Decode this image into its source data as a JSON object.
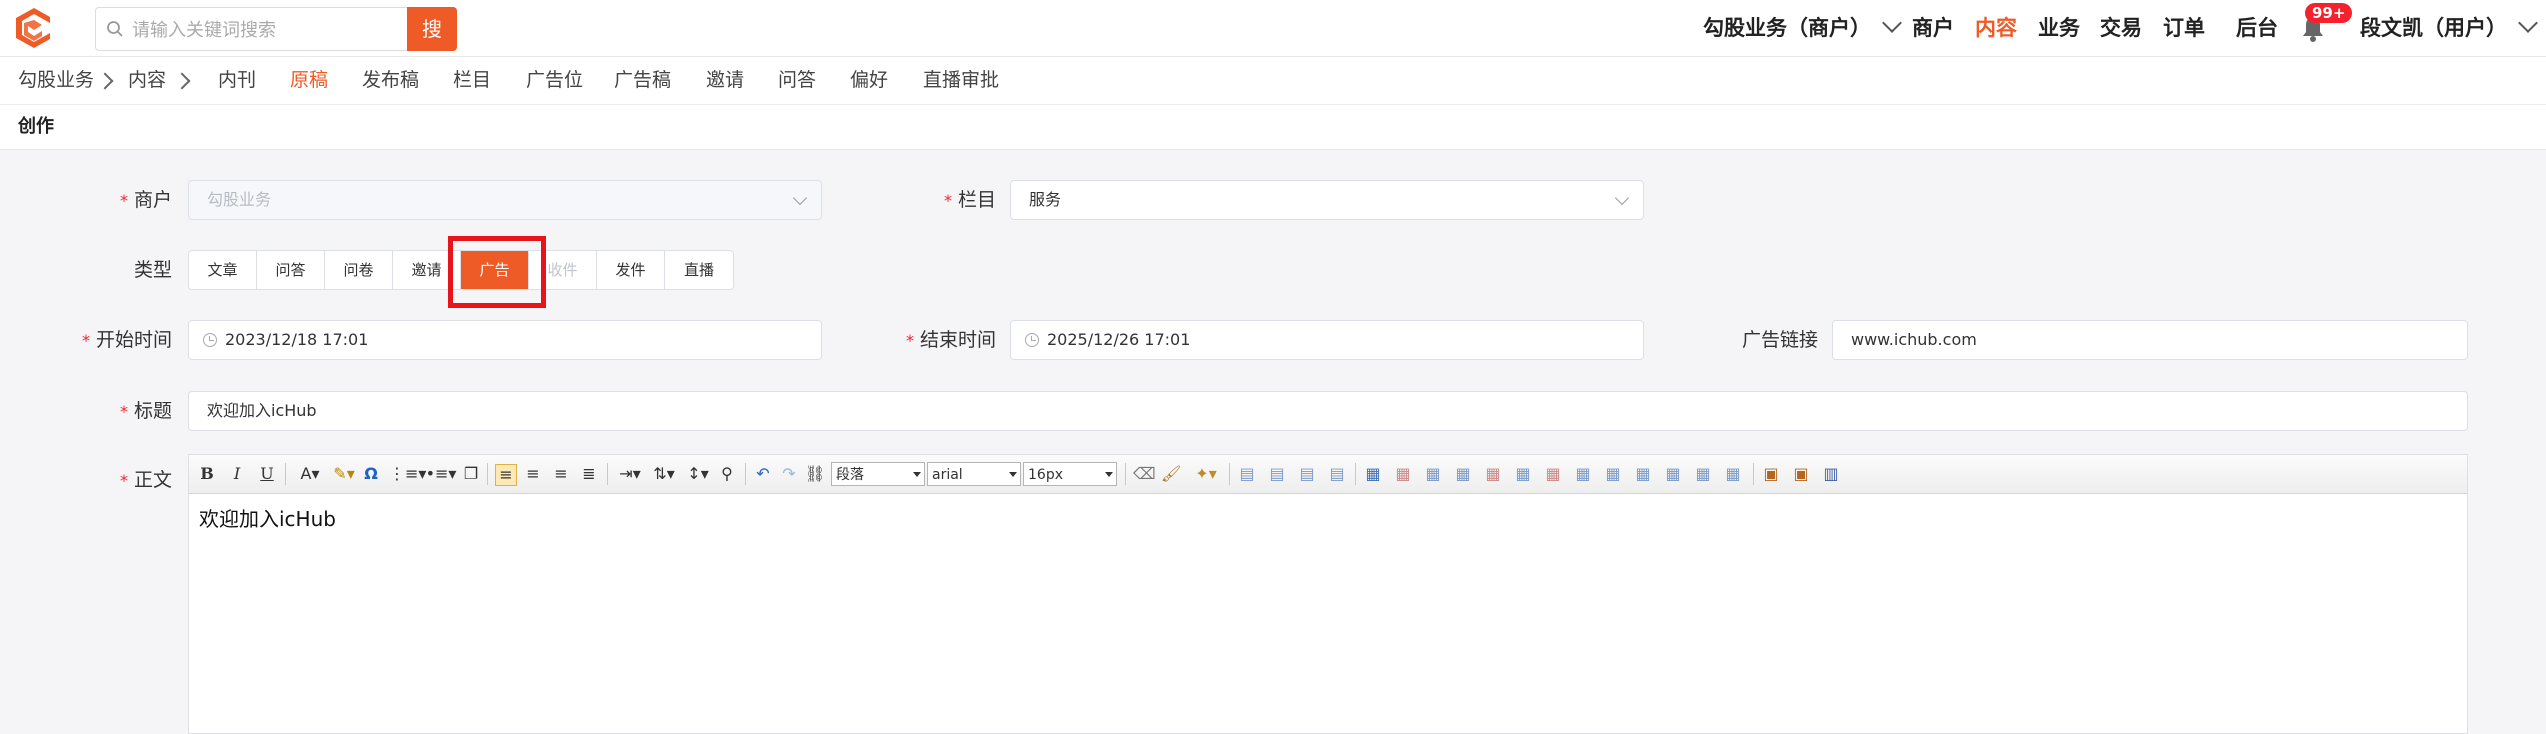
{
  "header": {
    "search_placeholder": "请输入关键词搜索",
    "search_button": "搜",
    "merchant_switch": "勾股业务（商户）",
    "nav": [
      "商户",
      "内容",
      "业务",
      "交易",
      "订单",
      "后台"
    ],
    "nav_active": "内容",
    "notification_badge": "99+",
    "user_menu": "段文凯（用户）"
  },
  "breadcrumb": {
    "items": [
      "勾股业务",
      "内容"
    ],
    "tabs": [
      "内刊",
      "原稿",
      "发布稿",
      "栏目",
      "广告位",
      "广告稿",
      "邀请",
      "问答",
      "偏好",
      "直播审批"
    ],
    "active_tab": "原稿"
  },
  "page": {
    "title": "创作"
  },
  "form": {
    "merchant": {
      "label": "商户",
      "value": "勾股业务"
    },
    "column": {
      "label": "栏目",
      "value": "服务"
    },
    "type": {
      "label": "类型",
      "options": [
        "文章",
        "问答",
        "问卷",
        "邀请",
        "广告",
        "收件",
        "发件",
        "直播"
      ],
      "selected": "广告",
      "disabled": [
        "收件"
      ]
    },
    "start_time": {
      "label": "开始时间",
      "value": "2023/12/18 17:01"
    },
    "end_time": {
      "label": "结束时间",
      "value": "2025/12/26 17:01"
    },
    "ad_link": {
      "label": "广告链接",
      "value": "www.ichub.com"
    },
    "title": {
      "label": "标题",
      "value": "欢迎加入icHub"
    },
    "body": {
      "label": "正文",
      "content": "欢迎加入icHub"
    }
  },
  "editor_toolbar": {
    "bold": "B",
    "italic": "I",
    "underline": "U",
    "omega": "Ω",
    "paragraph": "段落",
    "font": "arial",
    "size": "16px"
  },
  "colors": {
    "accent": "#ef5b26",
    "required": "#f5222d",
    "highlight": "#e8141b"
  }
}
